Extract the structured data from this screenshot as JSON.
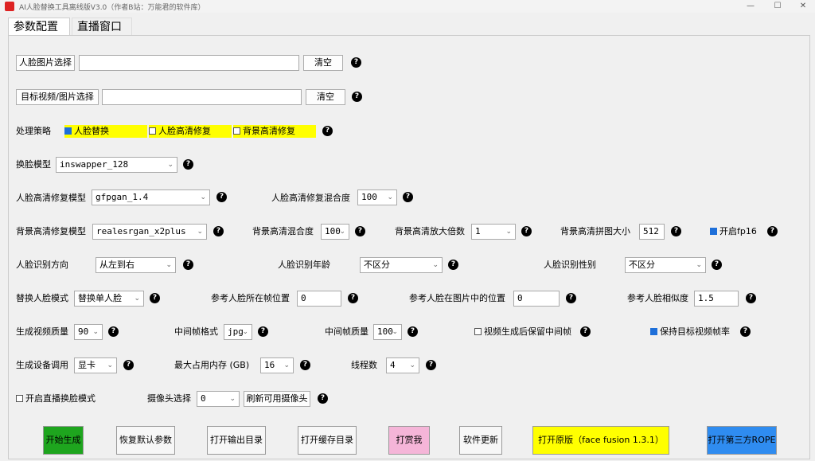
{
  "window": {
    "title": "AI人脸替换工具离线版V3.0（作者B站：万能君的软件库）",
    "minimize": "—",
    "maximize": "☐",
    "close": "✕"
  },
  "tabs": {
    "params": "参数配置",
    "live": "直播窗口"
  },
  "face_image": {
    "button": "人脸图片选择",
    "value": "",
    "clear": "清空"
  },
  "target": {
    "button": "目标视频/图片选择",
    "value": "",
    "clear": "清空"
  },
  "strategy": {
    "label": "处理策略",
    "options": [
      {
        "label": "人脸替换",
        "checked": true
      },
      {
        "label": "人脸高清修复",
        "checked": false
      },
      {
        "label": "背景高清修复",
        "checked": false
      }
    ]
  },
  "swap_model": {
    "label": "换脸模型",
    "value": "inswapper_128"
  },
  "face_enhance": {
    "label": "人脸高清修复模型",
    "value": "gfpgan_1.4",
    "blend_label": "人脸高清修复混合度",
    "blend_value": "100"
  },
  "bg_enhance": {
    "label": "背景高清修复模型",
    "value": "realesrgan_x2plus",
    "blend_label": "背景高清混合度",
    "blend_value": "100",
    "scale_label": "背景高清放大倍数",
    "scale_value": "1",
    "tile_label": "背景高清拼图大小",
    "tile_value": "512",
    "fp16_label": "开启fp16",
    "fp16_checked": true
  },
  "face_detect": {
    "dir_label": "人脸识别方向",
    "dir_value": "从左到右",
    "age_label": "人脸识别年龄",
    "age_value": "不区分",
    "gender_label": "人脸识别性别",
    "gender_value": "不区分"
  },
  "replace": {
    "mode_label": "替换人脸模式",
    "mode_value": "替换单人脸",
    "frame_label": "参考人脸所在帧位置",
    "frame_value": "0",
    "pos_label": "参考人脸在图片中的位置",
    "pos_value": "0",
    "sim_label": "参考人脸相似度",
    "sim_value": "1.5"
  },
  "output": {
    "quality_label": "生成视频质量",
    "quality_value": "90",
    "frame_fmt_label": "中间帧格式",
    "frame_fmt_value": "jpg",
    "frame_q_label": "中间帧质量",
    "frame_q_value": "100",
    "keep_frames_label": "视频生成后保留中间帧",
    "keep_frames_checked": false,
    "keep_fps_label": "保持目标视频帧率",
    "keep_fps_checked": true
  },
  "device": {
    "label": "生成设备调用",
    "value": "显卡",
    "mem_label": "最大占用内存 (GB)",
    "mem_value": "16",
    "threads_label": "线程数",
    "threads_value": "4"
  },
  "live": {
    "mode_label": "开启直播换脸模式",
    "mode_checked": false,
    "cam_label": "摄像头选择",
    "cam_value": "0",
    "refresh": "刷新可用摄像头"
  },
  "actions": {
    "start": "开始生成",
    "reset": "恢复默认参数",
    "open_out": "打开输出目录",
    "open_cache": "打开缓存目录",
    "donate": "打赏我",
    "update": "软件更新",
    "original": "打开原版（face fusion 1.3.1）",
    "rope": "打开第三方ROPE"
  },
  "help_glyph": "?",
  "colors": {
    "start": "#1ea51e",
    "donate": "#f5b5d8",
    "original": "#ffff00",
    "rope": "#2f8cf0",
    "highlight": "#ffff00"
  }
}
